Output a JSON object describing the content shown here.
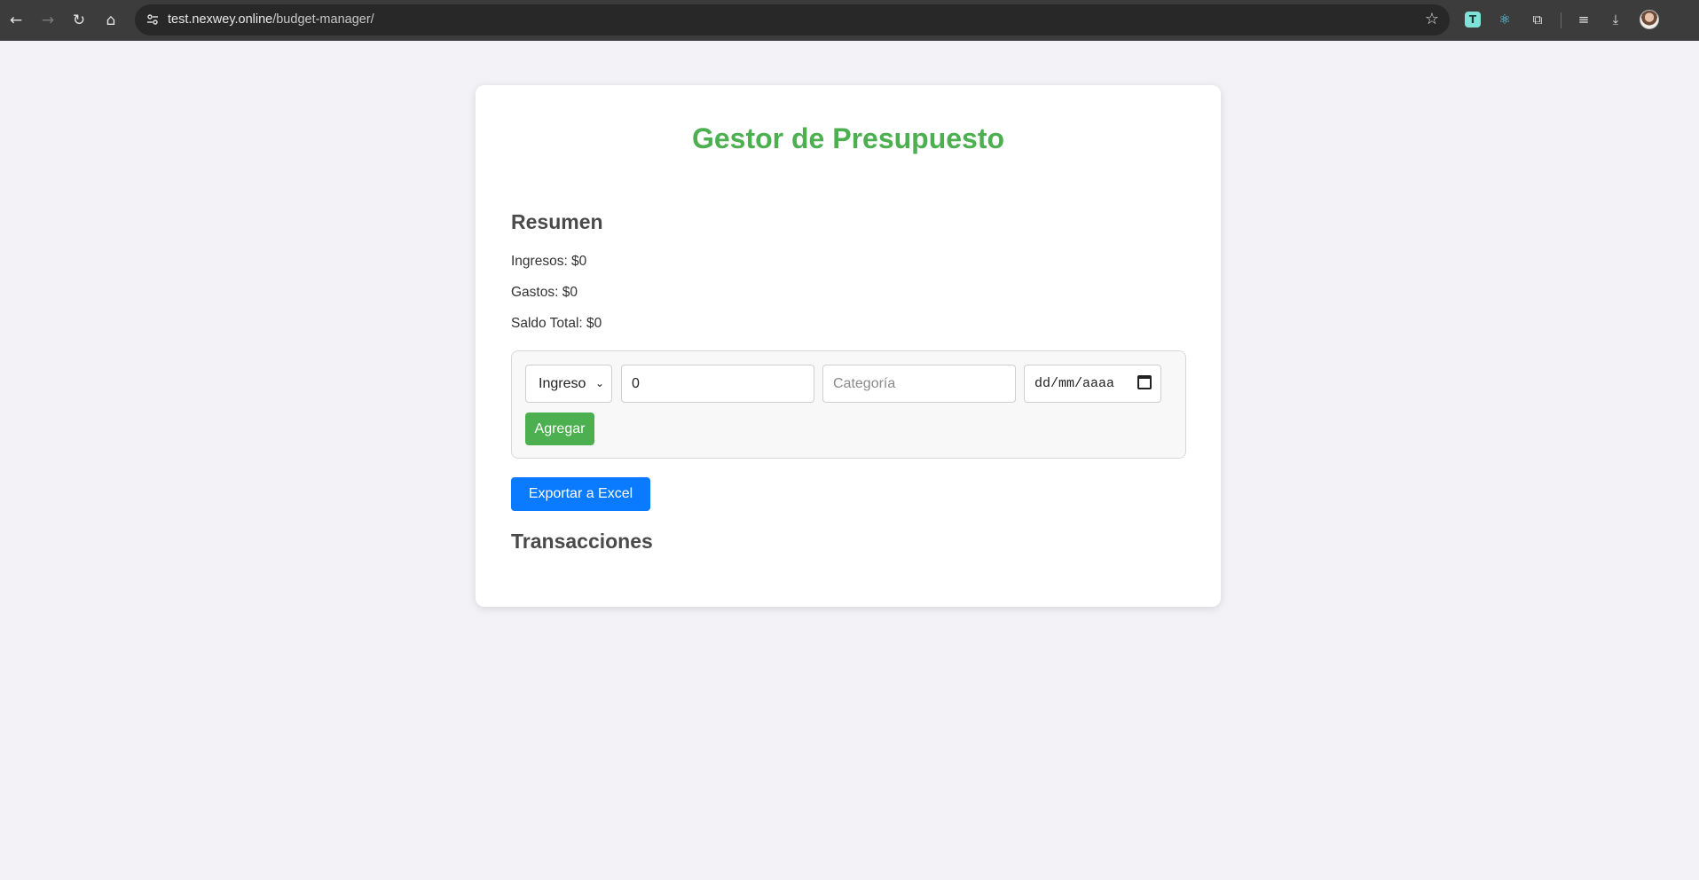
{
  "browser": {
    "url_host": "test.nexwey.online",
    "url_path": "/budget-manager/",
    "icons": {
      "back": "←",
      "forward": "→",
      "reload": "↻",
      "home": "⌂",
      "star": "☆",
      "ext_t": "T",
      "react": "⚛",
      "puzzle": "⧉",
      "media": "≡",
      "download": "⤓"
    }
  },
  "app": {
    "title": "Gestor de Presupuesto",
    "summary": {
      "heading": "Resumen",
      "income": "Ingresos: $0",
      "expenses": "Gastos: $0",
      "balance": "Saldo Total: $0"
    },
    "form": {
      "type_selected": "Ingreso",
      "amount_value": "0",
      "category_placeholder": "Categoría",
      "date_placeholder": "dd/mm/aaaa",
      "add_label": "Agregar"
    },
    "export_label": "Exportar a Excel",
    "transactions_heading": "Transacciones"
  },
  "colors": {
    "accent_green": "#4caf50",
    "accent_blue": "#0a7bff"
  }
}
